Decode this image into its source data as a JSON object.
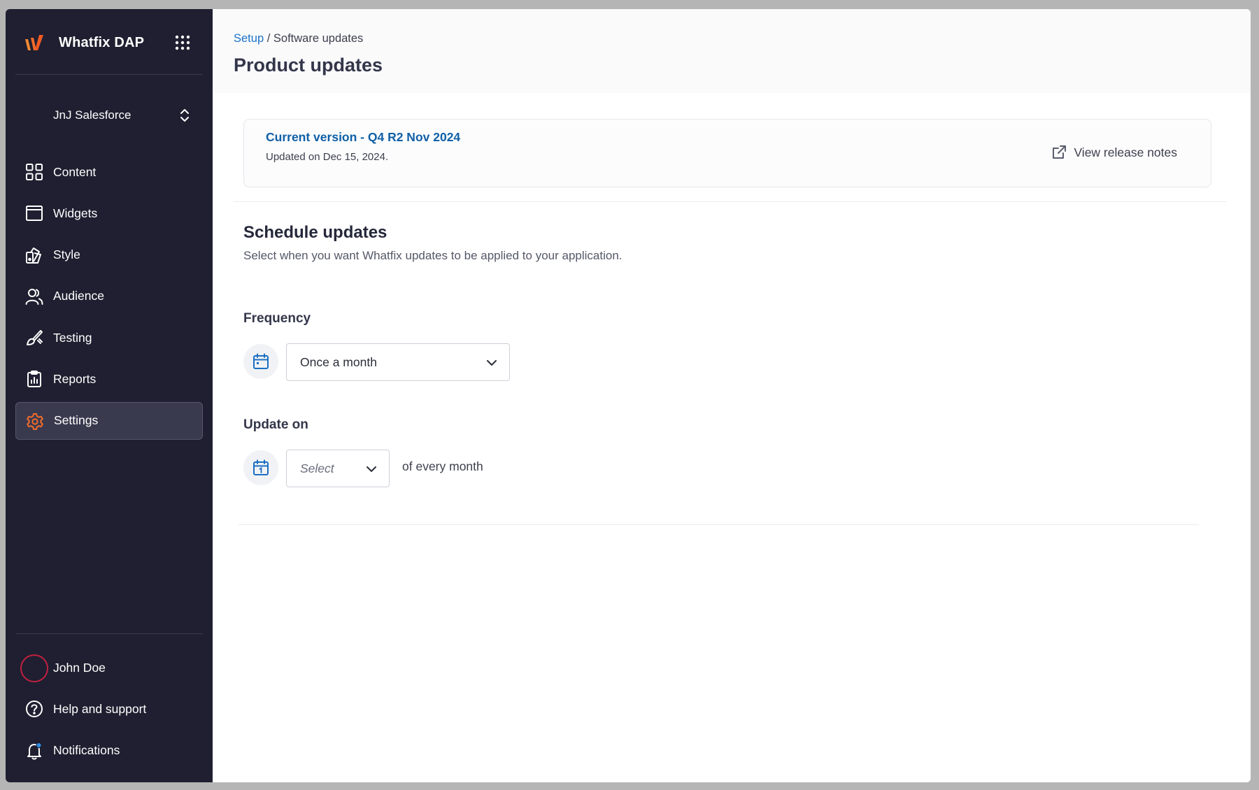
{
  "sidebar": {
    "brand": "Whatfix DAP",
    "app_switcher": "JnJ Salesforce",
    "nav": [
      {
        "label": "Content",
        "icon": "grid-icon"
      },
      {
        "label": "Widgets",
        "icon": "widget-window-icon"
      },
      {
        "label": "Style",
        "icon": "palette-icon"
      },
      {
        "label": "Audience",
        "icon": "users-icon"
      },
      {
        "label": "Testing",
        "icon": "brush-icon"
      },
      {
        "label": "Reports",
        "icon": "clipboard-chart-icon"
      },
      {
        "label": "Settings",
        "icon": "gear-icon",
        "active": true
      }
    ],
    "bottom": [
      {
        "label": "John Doe",
        "icon": "avatar"
      },
      {
        "label": "Help and support",
        "icon": "help-circle-icon"
      },
      {
        "label": "Notifications",
        "icon": "bell-icon"
      }
    ]
  },
  "header": {
    "breadcrumb_link": "Setup",
    "breadcrumb_sep": " / ",
    "breadcrumb_current": "Software updates",
    "title": "Product updates"
  },
  "version": {
    "title": "Current version - Q4 R2 Nov 2024",
    "updated": "Updated on Dec 15, 2024.",
    "release_link": "View release notes"
  },
  "schedule": {
    "title": "Schedule updates",
    "description": "Select when you want Whatfix updates to be applied to your application.",
    "frequency_label": "Frequency",
    "frequency_value": "Once a month",
    "update_on_label": "Update on",
    "update_on_placeholder": "Select",
    "update_on_suffix": "of every month"
  },
  "colors": {
    "sidebar_bg": "#1f1f31",
    "accent_orange": "#f26b2a",
    "link_blue": "#1a73c9",
    "icon_blue": "#1b6fc2",
    "avatar_ring": "#c0203f",
    "notification_dot": "#2e8fe8"
  }
}
